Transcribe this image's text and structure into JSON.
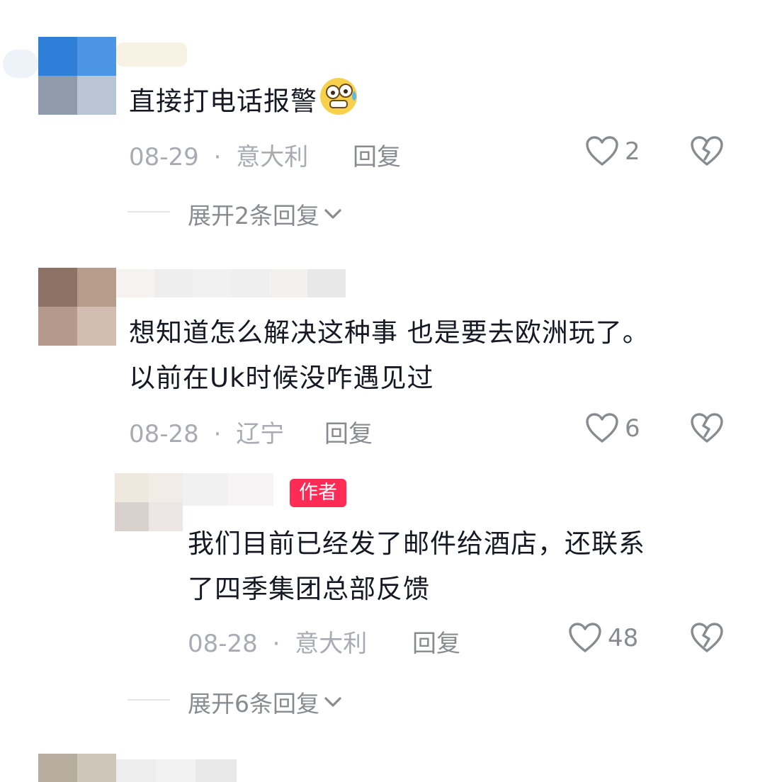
{
  "comments": [
    {
      "text_lines": [
        "直接打电话报警"
      ],
      "emoji": "sweat-grin-emoji",
      "date": "08-29",
      "location": "意大利",
      "reply_label": "回复",
      "likes": "2",
      "expand_label": "展开2条回复"
    },
    {
      "text_lines": [
        "想知道怎么解决这种事 也是要去欧洲玩了。",
        "以前在Uk时候没咋遇见过"
      ],
      "date": "08-28",
      "location": "辽宁",
      "reply_label": "回复",
      "likes": "6"
    },
    {
      "badge": "作者",
      "text_lines": [
        "我们目前已经发了邮件给酒店，还联系",
        "了四季集团总部反馈"
      ],
      "date": "08-28",
      "location": "意大利",
      "reply_label": "回复",
      "likes": "48",
      "expand_label": "展开6条回复"
    }
  ],
  "separator": "·",
  "icons": {
    "like": "heart-outline-icon",
    "dislike": "broken-heart-icon",
    "expand": "chevron-down-icon"
  },
  "colors": {
    "text": "#161823",
    "meta": "#a9abb3",
    "secondary": "#8a8b91",
    "badge": "#fe2c55"
  }
}
